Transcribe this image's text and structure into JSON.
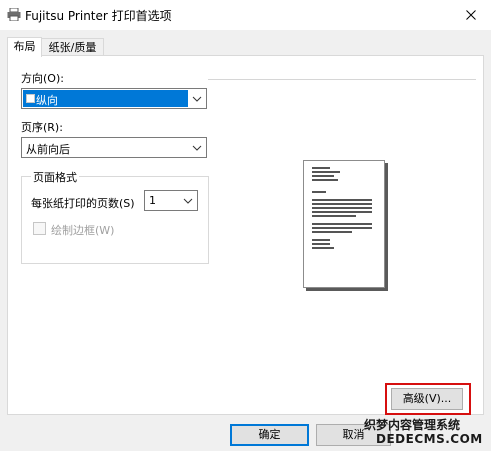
{
  "window": {
    "title": "Fujitsu Printer 打印首选项",
    "close_icon": "close-icon"
  },
  "tabs": [
    {
      "label": "布局",
      "active": true
    },
    {
      "label": "纸张/质量",
      "active": false
    }
  ],
  "orientation": {
    "label": "方向(O):",
    "value": "纵向",
    "icon": "portrait-page-icon"
  },
  "page_order": {
    "label": "页序(R):",
    "value": "从前向后"
  },
  "page_format": {
    "title": "页面格式",
    "pages_per_sheet_label": "每张纸打印的页数(S)",
    "pages_per_sheet_value": "1",
    "draw_borders_label": "绘制边框(W)",
    "draw_borders_checked": false,
    "draw_borders_enabled": false
  },
  "buttons": {
    "advanced": "高级(V)...",
    "ok": "确定",
    "cancel": "取消"
  },
  "watermark": {
    "line1": "织梦内容管理系统",
    "line2": "DEDECMS.COM"
  },
  "colors": {
    "accent": "#0078d7",
    "annotation": "#d60f0f"
  }
}
